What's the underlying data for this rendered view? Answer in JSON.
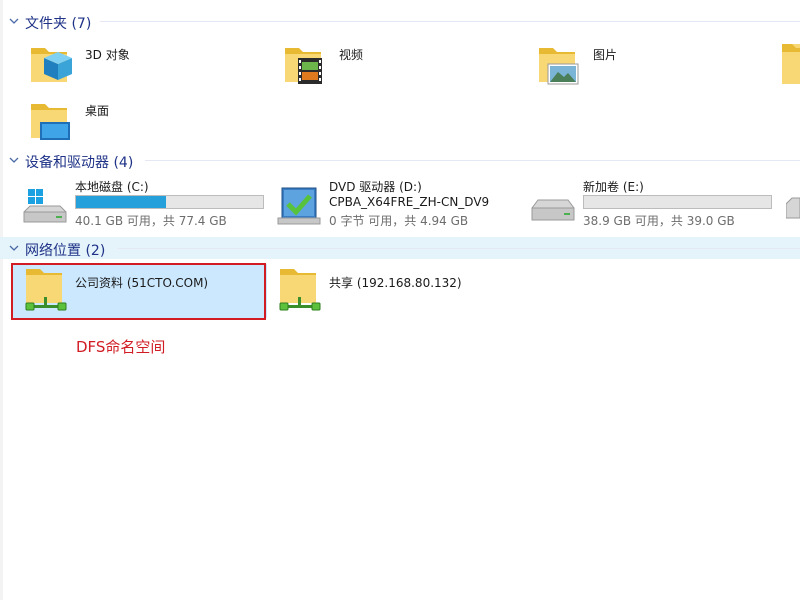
{
  "groups": {
    "folders": {
      "label": "文件夹 (7)"
    },
    "devices": {
      "label": "设备和驱动器 (4)"
    },
    "network": {
      "label": "网络位置 (2)"
    }
  },
  "folders": [
    {
      "label": "3D 对象",
      "icon": "3d-objects-folder-icon"
    },
    {
      "label": "视频",
      "icon": "videos-folder-icon"
    },
    {
      "label": "图片",
      "icon": "pictures-folder-icon"
    },
    {
      "label": "桌面",
      "icon": "desktop-folder-icon"
    }
  ],
  "drives": [
    {
      "label": "本地磁盘 (C:)",
      "free_text": "40.1 GB 可用，共 77.4 GB",
      "used_fraction": 0.48,
      "icon": "windows-drive-icon"
    },
    {
      "label": "DVD 驱动器 (D:)",
      "volume": "CPBA_X64FRE_ZH-CN_DV9",
      "free_text": "0 字节 可用，共 4.94 GB",
      "icon": "dvd-drive-icon"
    },
    {
      "label": "新加卷 (E:)",
      "free_text": "38.9 GB 可用，共 39.0 GB",
      "used_fraction": 0.0,
      "icon": "hard-drive-icon"
    }
  ],
  "network_locations": [
    {
      "label": "公司资料 (51CTO.COM)",
      "icon": "network-folder-icon",
      "selected": true
    },
    {
      "label": "共享 (192.168.80.132)",
      "icon": "network-folder-icon",
      "selected": false
    }
  ],
  "annotation": {
    "text": "DFS命名空间"
  },
  "colors": {
    "group_header_text": "#1e3287",
    "selection_bg": "#cce8ff",
    "bar_fill": "#26a0da",
    "annotation_red": "#d11c24"
  }
}
